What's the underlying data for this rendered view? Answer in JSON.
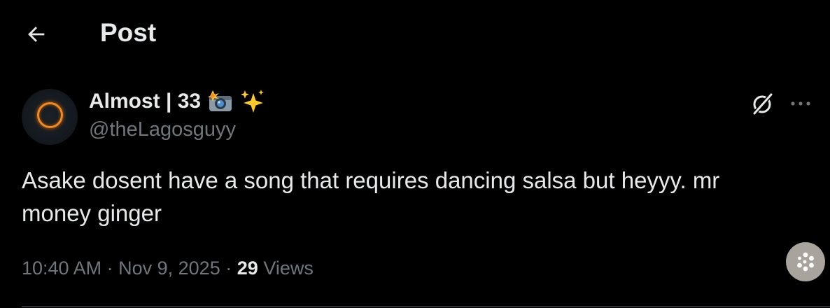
{
  "header": {
    "title": "Post",
    "back_icon": "arrow-left-icon"
  },
  "author": {
    "display_name": "Almost | 33",
    "name_emojis": [
      "camera-flash-emoji",
      "sparkles-emoji"
    ],
    "handle": "@theLagosguyy",
    "avatar_icon": "orange-ring-eclipse-avatar"
  },
  "post": {
    "text": "Asake dosent have a song that requires dancing salsa but heyyy. mr money ginger"
  },
  "meta": {
    "time": "10:40 AM",
    "separator": "·",
    "date": "Nov 9, 2025",
    "views_count": "29",
    "views_label": "Views"
  },
  "actions": {
    "grok_icon": "grok-icon",
    "more_icon": "more-dots-icon",
    "fab_icon": "dots-circle-icon"
  },
  "colors": {
    "background": "#000000",
    "primary_text": "#e7e9ea",
    "secondary_text": "#71767b",
    "divider": "#2f3336",
    "fab": "#a8a39c",
    "avatar_ring": "#f08a1c"
  }
}
